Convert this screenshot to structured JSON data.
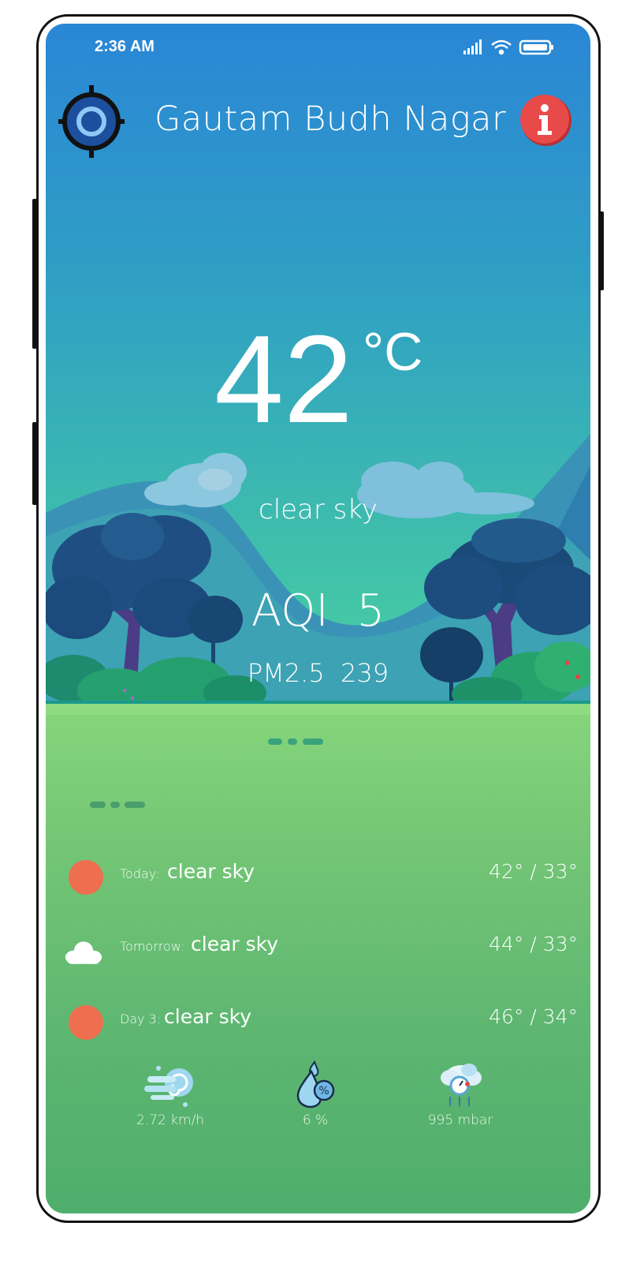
{
  "status_bar": {
    "time": "2:36 AM",
    "icons": [
      "signal-icon",
      "wifi-icon",
      "battery-icon"
    ]
  },
  "header": {
    "location_icon": "crosshair-location-icon",
    "city": "Gautam Budh Nagar",
    "info_icon": "info-icon"
  },
  "current": {
    "temperature": "42",
    "unit": "°C",
    "condition": "clear sky",
    "aqi_label": "AQI",
    "aqi_value": "5",
    "pm_label": "PM2.5",
    "pm_value": "239"
  },
  "forecast": [
    {
      "label": "Today:",
      "condition": "clear sky",
      "temps": "42° / 33°",
      "icon": "sun-icon"
    },
    {
      "label": "Tomorrow:",
      "condition": "clear sky",
      "temps": "44° / 33°",
      "icon": "cloud-icon"
    },
    {
      "label": "Day 3:",
      "condition": "clear sky",
      "temps": "46° / 34°",
      "icon": "sun-icon"
    }
  ],
  "stats": {
    "wind": {
      "icon": "wind-icon",
      "value": "2.72 km/h"
    },
    "humidity": {
      "icon": "humidity-drop-icon",
      "value": "6 %"
    },
    "pressure": {
      "icon": "pressure-gauge-icon",
      "value": "995 mbar"
    }
  },
  "colors": {
    "sky_top": "#2a86d6",
    "sky_bottom": "#44c7a6",
    "grass": "#76c776",
    "sun": "#ee6e50",
    "info": "#e84a4a"
  }
}
